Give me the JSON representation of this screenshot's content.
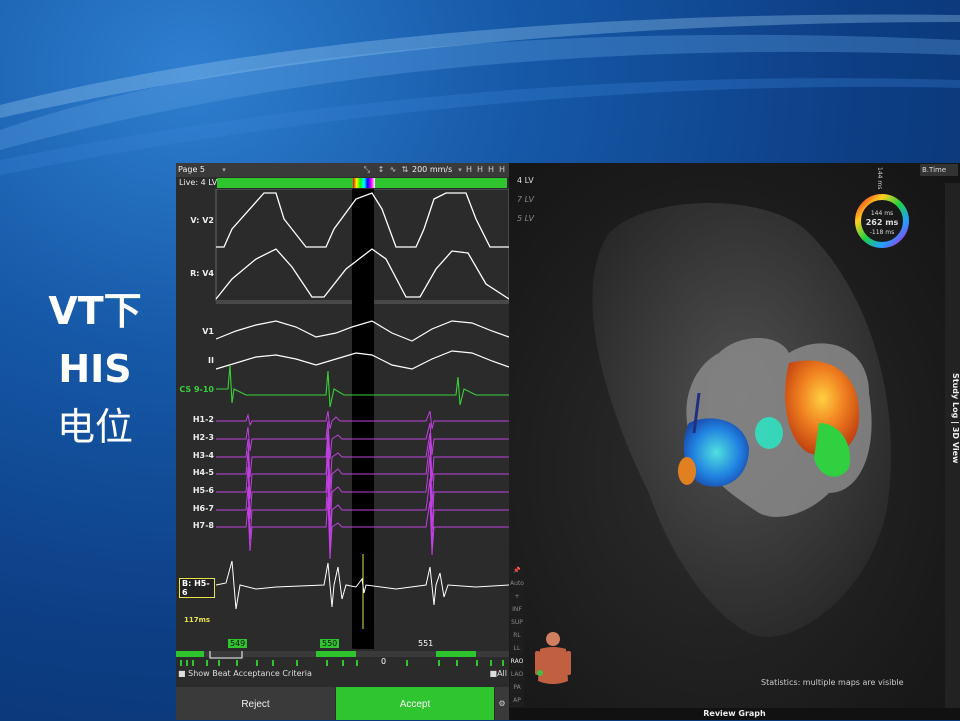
{
  "slide": {
    "title_lines": [
      "VT下",
      "HIS",
      "电位"
    ]
  },
  "egm": {
    "page": "Page 5",
    "sweep_speed": "200 mm/s",
    "live_label": "Live: 4 LV",
    "tools": [
      "H",
      "H",
      "H",
      "H"
    ],
    "channels": [
      {
        "label": "V: V2",
        "color": "#ffffff"
      },
      {
        "label": "R: V4",
        "color": "#ffffff"
      },
      {
        "label": "V1",
        "color": "#ffffff"
      },
      {
        "label": "II",
        "color": "#ffffff"
      },
      {
        "label": "CS 9-10",
        "color": "#39d039"
      },
      {
        "label": "H1-2",
        "color": "#c040e0"
      },
      {
        "label": "H2-3",
        "color": "#c040e0"
      },
      {
        "label": "H3-4",
        "color": "#c040e0"
      },
      {
        "label": "H4-5",
        "color": "#c040e0"
      },
      {
        "label": "H5-6",
        "color": "#c040e0"
      },
      {
        "label": "H6-7",
        "color": "#c040e0"
      },
      {
        "label": "H7-8",
        "color": "#c040e0"
      },
      {
        "label": "B: H5-6",
        "color": "#ffffff"
      }
    ],
    "b_channel_ms": "117ms",
    "beats": [
      "549",
      "550",
      "551"
    ],
    "timeline_marker": "0",
    "show_beat_criteria": "Show Beat Acceptance Criteria",
    "all_label": "All",
    "reject_label": "Reject",
    "accept_label": "Accept"
  },
  "view3d": {
    "maps": [
      {
        "label": "4 LV",
        "active": true
      },
      {
        "label": "7 LV",
        "active": false
      },
      {
        "label": "5 LV",
        "active": false
      }
    ],
    "map_mode": "B.Time",
    "ring_top": "144 ms",
    "ring_center": "262 ms",
    "ring_bottom": "-118 ms",
    "ring_vertical": "144 ms",
    "side_tools": [
      "Auto",
      "+",
      "INF",
      "SUP",
      "RL",
      "LL",
      "RAO",
      "LAO",
      "PA",
      "AP"
    ],
    "statistics": "Statistics: multiple maps are visible",
    "study_log": "Study Log | 3D View",
    "review_graph": "Review Graph",
    "accent_green": "#2ec52e"
  }
}
